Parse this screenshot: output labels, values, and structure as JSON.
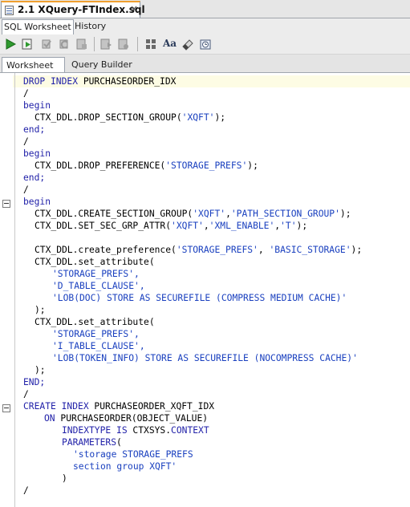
{
  "file_tab": {
    "title": "2.1 XQuery-FTIndex.sql",
    "close": "×"
  },
  "sub_tabs": {
    "worksheet": "SQL Worksheet",
    "history": "History"
  },
  "toolbar": {
    "icons": [
      "run-statement-icon",
      "run-script-icon",
      "commit-icon",
      "rollback-icon",
      "autotrace-icon",
      "explain-plan-icon",
      "sql-tuning-icon",
      "clear-icon",
      "format-icon",
      "eraser-icon",
      "history-icon"
    ],
    "aa_label": "Aa"
  },
  "ws_tabs": {
    "worksheet": "Worksheet",
    "query_builder": "Query Builder"
  },
  "code": {
    "l1_a": "DROP INDEX",
    "l1_b": " PURCHASEORDER_IDX",
    "slash": "/",
    "begin": "begin",
    "end": "end;",
    "END": "END;",
    "l4_a": "CTX_DDL.DROP_SECTION_GROUP(",
    "l4_s": "'XQFT'",
    "l4_b": ");",
    "l8_a": "CTX_DDL.DROP_PREFERENCE(",
    "l8_s": "'STORAGE_PREFS'",
    "l8_b": ");",
    "l12_a": "CTX_DDL.CREATE_SECTION_GROUP(",
    "l12_s1": "'XQFT'",
    "l12_s2": "'PATH_SECTION_GROUP'",
    "l12_b": ");",
    "l13_a": "CTX_DDL.SET_SEC_GRP_ATTR(",
    "l13_s1": "'XQFT'",
    "l13_s2": "'XML_ENABLE'",
    "l13_s3": "'T'",
    "l13_b": ");",
    "l15_a": "CTX_DDL.create_preference(",
    "l15_s1": "'STORAGE_PREFS'",
    "l15_s2": "'BASIC_STORAGE'",
    "l15_b": ");",
    "set_attr": "CTX_DDL.set_attribute(",
    "s_storage": "'STORAGE_PREFS',",
    "s_dtable": "'D_TABLE_CLAUSE',",
    "s_lobdoc": "'LOB(DOC) STORE AS SECUREFILE (COMPRESS MEDIUM CACHE)'",
    "close_paren": ");",
    "s_itable": "'I_TABLE_CLAUSE',",
    "s_lobtoken": "'LOB(TOKEN_INFO) STORE AS SECUREFILE (NOCOMPRESS CACHE)'",
    "l27_a": "CREATE INDEX",
    "l27_b": " PURCHASEORDER_XQFT_IDX",
    "l28_a": "ON",
    "l28_b": " PURCHASEORDER(OBJECT_VALUE)",
    "l29_a": "INDEXTYPE IS",
    "l29_b": " CTXSYS.",
    "l29_c": "CONTEXT",
    "l30_a": "PARAMETERS",
    "l30_b": "(",
    "l31": "'storage STORAGE_PREFS",
    "l32": "section group XQFT'",
    "l33": ")"
  }
}
